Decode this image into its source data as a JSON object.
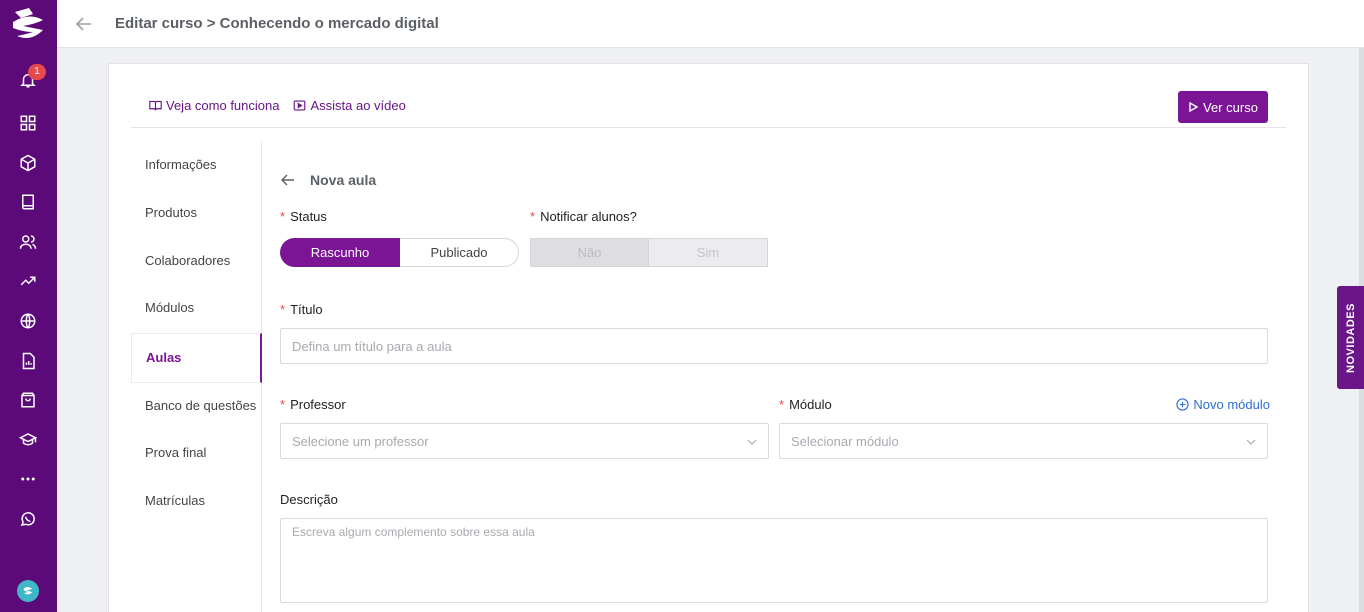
{
  "header": {
    "breadcrumb": "Editar curso > Conhecendo o mercado digital"
  },
  "sidebar": {
    "notification_count": "1",
    "icons": [
      "logo-icon",
      "bell-icon",
      "grid-icon",
      "cube-icon",
      "book-icon",
      "users-icon",
      "trending-up-icon",
      "globe-icon",
      "report-icon",
      "shopping-bag-icon",
      "graduation-cap-icon",
      "more-icon",
      "whatsapp-icon",
      "avatar"
    ]
  },
  "help": {
    "how_it_works": "Veja como funciona",
    "watch_video": "Assista ao vídeo"
  },
  "actions": {
    "view_course": "Ver curso"
  },
  "subnav": {
    "items": [
      "Informações",
      "Produtos",
      "Colaboradores",
      "Módulos",
      "Aulas",
      "Banco de questões",
      "Prova final",
      "Matrículas"
    ],
    "active": "Aulas"
  },
  "form": {
    "title": "Nova aula",
    "status": {
      "label": "Status",
      "options": [
        "Rascunho",
        "Publicado"
      ],
      "selected": "Rascunho"
    },
    "notify": {
      "label": "Notificar alunos?",
      "options": [
        "Não",
        "Sim"
      ],
      "selected": "Não"
    },
    "titulo": {
      "label": "Título",
      "placeholder": "Defina um título para a aula"
    },
    "professor": {
      "label": "Professor",
      "placeholder": "Selecione um professor"
    },
    "modulo": {
      "label": "Módulo",
      "placeholder": "Selecionar módulo",
      "new_label": "Novo módulo"
    },
    "descricao": {
      "label": "Descrição",
      "placeholder": "Escreva algum complemento sobre essa aula"
    }
  },
  "novidades": "NOVIDADES",
  "colors": {
    "brand": "#7b1596",
    "sidebar": "#5c0a7a",
    "required": "#e5484d",
    "link": "#2f6ecf"
  }
}
